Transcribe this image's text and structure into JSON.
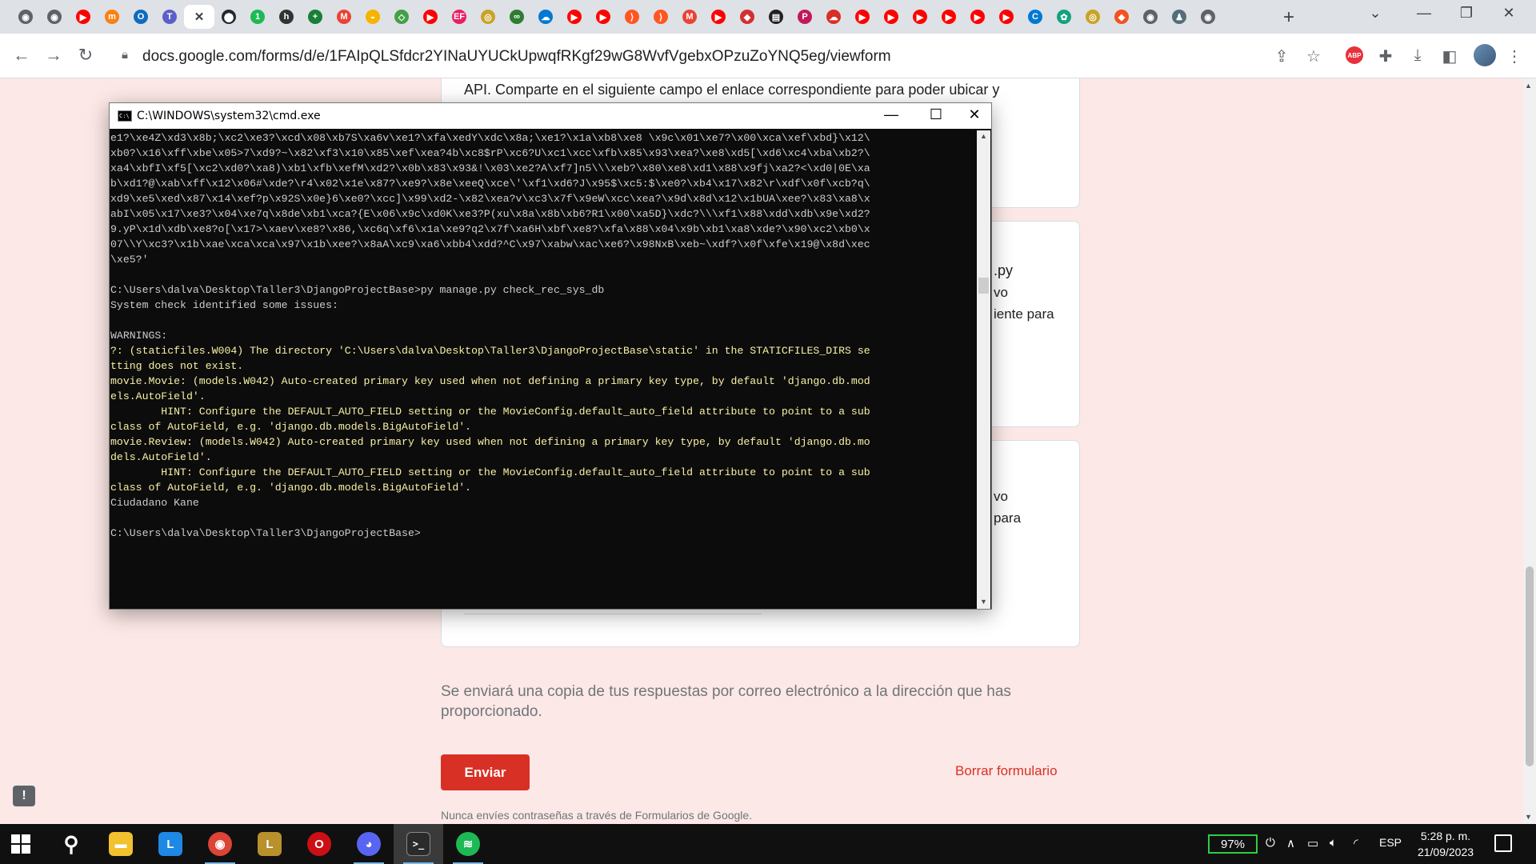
{
  "browser": {
    "tabs": [
      {
        "name": "chrome-tab-icon",
        "color": "#5f6368",
        "glyph": "◉"
      },
      {
        "name": "chrome-tab-icon",
        "color": "#5f6368",
        "glyph": "◉"
      },
      {
        "name": "youtube-tab-icon",
        "color": "#ff0000",
        "glyph": "▶"
      },
      {
        "name": "moodle-tab-icon",
        "color": "#f98012",
        "glyph": "m"
      },
      {
        "name": "outlook-tab-icon",
        "color": "#0f6cbd",
        "glyph": "O"
      },
      {
        "name": "teams-tab-icon",
        "color": "#5b5fc7",
        "glyph": "T"
      },
      {
        "name": "google-forms-tab-icon",
        "color": "#673ab7",
        "glyph": "✕",
        "active": true
      },
      {
        "name": "github-tab-icon",
        "color": "#24292f",
        "glyph": "⬤"
      },
      {
        "name": "tab-icon",
        "color": "#1db954",
        "glyph": "1"
      },
      {
        "name": "tab-icon",
        "color": "#333333",
        "glyph": "h"
      },
      {
        "name": "add-tab-icon",
        "color": "#188038",
        "glyph": "+"
      },
      {
        "name": "gmail-tab-icon",
        "color": "#ea4335",
        "glyph": "M"
      },
      {
        "name": "tab-icon",
        "color": "#f4b400",
        "glyph": "◒"
      },
      {
        "name": "tab-icon",
        "color": "#43a047",
        "glyph": "◇"
      },
      {
        "name": "youtube-tab-icon",
        "color": "#ff0000",
        "glyph": "▶"
      },
      {
        "name": "tab-icon",
        "color": "#e91e63",
        "glyph": "EF"
      },
      {
        "name": "tab-icon",
        "color": "#c9a227",
        "glyph": "◎"
      },
      {
        "name": "tab-icon",
        "color": "#2e7d32",
        "glyph": "∞"
      },
      {
        "name": "onedrive-tab-icon",
        "color": "#0078d4",
        "glyph": "☁"
      },
      {
        "name": "youtube-tab-icon",
        "color": "#ff0000",
        "glyph": "▶"
      },
      {
        "name": "youtube-tab-icon",
        "color": "#ff0000",
        "glyph": "▶"
      },
      {
        "name": "tab-icon",
        "color": "#ff5722",
        "glyph": "⟩"
      },
      {
        "name": "tab-icon",
        "color": "#ff5722",
        "glyph": "⟩"
      },
      {
        "name": "gmail-tab-icon",
        "color": "#ea4335",
        "glyph": "M"
      },
      {
        "name": "youtube-tab-icon",
        "color": "#ff0000",
        "glyph": "▶"
      },
      {
        "name": "tab-icon",
        "color": "#d32f2f",
        "glyph": "◆"
      },
      {
        "name": "tab-icon",
        "color": "#212121",
        "glyph": "▤"
      },
      {
        "name": "tab-icon",
        "color": "#c2185b",
        "glyph": "P"
      },
      {
        "name": "tab-icon",
        "color": "#d93025",
        "glyph": "☁"
      },
      {
        "name": "youtube-tab-icon",
        "color": "#ff0000",
        "glyph": "▶"
      },
      {
        "name": "youtube-tab-icon",
        "color": "#ff0000",
        "glyph": "▶"
      },
      {
        "name": "youtube-tab-icon",
        "color": "#ff0000",
        "glyph": "▶"
      },
      {
        "name": "youtube-tab-icon",
        "color": "#ff0000",
        "glyph": "▶"
      },
      {
        "name": "youtube-tab-icon",
        "color": "#ff0000",
        "glyph": "▶"
      },
      {
        "name": "youtube-tab-icon",
        "color": "#ff0000",
        "glyph": "▶"
      },
      {
        "name": "tab-icon",
        "color": "#0078d4",
        "glyph": "C"
      },
      {
        "name": "chatgpt-tab-icon",
        "color": "#10a37f",
        "glyph": "✿"
      },
      {
        "name": "tab-icon",
        "color": "#c9a227",
        "glyph": "◎"
      },
      {
        "name": "tab-icon",
        "color": "#f4511e",
        "glyph": "◆"
      },
      {
        "name": "chrome-tab-icon",
        "color": "#5f6368",
        "glyph": "◉"
      },
      {
        "name": "tab-icon",
        "color": "#546e7a",
        "glyph": "♟"
      },
      {
        "name": "chrome-tab-icon",
        "color": "#5f6368",
        "glyph": "◉"
      }
    ],
    "url": "docs.google.com/forms/d/e/1FAIpQLSfdcr2YINaUYUCkUpwqfRKgf29wG8WvfVgebxOPzuZoYNQ5eg/viewform"
  },
  "form": {
    "q1_text": "API. Comparte en el siguiente campo el enlace correspondiente para poder ubicar y",
    "q2_peek": [
      ".py",
      "vo",
      "iente para"
    ],
    "q3_peek": [
      "vo",
      "para"
    ],
    "email_note": "Se enviará una copia de tus respuestas por correo electrónico a la dirección que has proporcionado.",
    "submit_label": "Enviar",
    "clear_label": "Borrar formulario",
    "password_note": "Nunca envíes contraseñas a través de Formularios de Google.",
    "accent_color": "#d93025"
  },
  "cmd": {
    "title": "C:\\WINDOWS\\system32\\cmd.exe",
    "icon_text": "C:\\",
    "lines": [
      {
        "t": "e1?\\xe4Z\\xd3\\x8b;\\xc2\\xe3?\\xcd\\x08\\xb7S\\xa6v\\xe1?\\xfa\\xedY\\xdc\\x8a;\\xe1?\\x1a\\xb8\\xe8 \\x9c\\x01\\xe7?\\x00\\xca\\xef\\xbd}\\x12\\"
      },
      {
        "t": "xb0?\\x16\\xff\\xbe\\x05>7\\xd9?~\\x82\\xf3\\x10\\x85\\xef\\xea?4b\\xc8$rP\\xc6?U\\xc1\\xcc\\xfb\\x85\\x93\\xea?\\xe8\\xd5[\\xd6\\xc4\\xba\\xb2?\\"
      },
      {
        "t": "xa4\\xbfI\\xf5[\\xc2\\xd0?\\xa8)\\xb1\\xfb\\xefM\\xd2?\\x0b\\x83\\x93&!\\x03\\xe2?A\\xf7]n5\\\\\\xeb?\\x80\\xe8\\xd1\\x88\\x9fj\\xa2?<\\xd0|0E\\xa"
      },
      {
        "t": "b\\xd1?@\\xab\\xff\\x12\\x06#\\xde?\\r4\\x02\\x1e\\x87?\\xe9?\\x8e\\xeeQ\\xce\\'\\xf1\\xd6?J\\x95$\\xc5:$\\xe0?\\xb4\\x17\\x82\\r\\xdf\\x0f\\xcb?q\\"
      },
      {
        "t": "xd9\\xe5\\xed\\x87\\x14\\xef?p\\x92S\\x0e}6\\xe0?\\xcc]\\x99\\xd2-\\x82\\xea?v\\xc3\\x7f\\x9eW\\xcc\\xea?\\x9d\\x8d\\x12\\x1bUA\\xee?\\x83\\xa8\\x"
      },
      {
        "t": "abI\\x05\\x17\\xe3?\\x04\\xe7q\\x8de\\xb1\\xca?{E\\x06\\x9c\\xd0K\\xe3?P(xu\\x8a\\x8b\\xb6?R1\\x00\\xa5D}\\xdc?\\\\\\xf1\\x88\\xdd\\xdb\\x9e\\xd2?"
      },
      {
        "t": "9.yP\\x1d\\xdb\\xe8?o[\\x17>\\xaev\\xe8?\\x86,\\xc6q\\xf6\\x1a\\xe9?q2\\x7f\\xa6H\\xbf\\xe8?\\xfa\\x88\\x04\\x9b\\xb1\\xa8\\xde?\\x90\\xc2\\xb0\\x"
      },
      {
        "t": "07\\\\Y\\xc3?\\x1b\\xae\\xca\\xca\\x97\\x1b\\xee?\\x8aA\\xc9\\xa6\\xbb4\\xdd?^C\\x97\\xabw\\xac\\xe6?\\x98NxB\\xeb~\\xdf?\\x0f\\xfe\\x19@\\x8d\\xec"
      },
      {
        "t": "\\xe5?'"
      },
      {
        "t": ""
      },
      {
        "t": "C:\\Users\\dalva\\Desktop\\Taller3\\DjangoProjectBase>py manage.py check_rec_sys_db"
      },
      {
        "t": "System check identified some issues:"
      },
      {
        "t": ""
      },
      {
        "t": "WARNINGS:"
      },
      {
        "t": "?: (staticfiles.W004) The directory 'C:\\Users\\dalva\\Desktop\\Taller3\\DjangoProjectBase\\static' in the STATICFILES_DIRS se",
        "warn": true
      },
      {
        "t": "tting does not exist.",
        "warn": true
      },
      {
        "t": "movie.Movie: (models.W042) Auto-created primary key used when not defining a primary key type, by default 'django.db.mod",
        "warn": true
      },
      {
        "t": "els.AutoField'.",
        "warn": true
      },
      {
        "t": "        HINT: Configure the DEFAULT_AUTO_FIELD setting or the MovieConfig.default_auto_field attribute to point to a sub",
        "warn": true
      },
      {
        "t": "class of AutoField, e.g. 'django.db.models.BigAutoField'.",
        "warn": true
      },
      {
        "t": "movie.Review: (models.W042) Auto-created primary key used when not defining a primary key type, by default 'django.db.mo",
        "warn": true
      },
      {
        "t": "dels.AutoField'.",
        "warn": true
      },
      {
        "t": "        HINT: Configure the DEFAULT_AUTO_FIELD setting or the MovieConfig.default_auto_field attribute to point to a sub",
        "warn": true
      },
      {
        "t": "class of AutoField, e.g. 'django.db.models.BigAutoField'.",
        "warn": true
      },
      {
        "t": "Ciudadano Kane"
      },
      {
        "t": ""
      },
      {
        "t": "C:\\Users\\dalva\\Desktop\\Taller3\\DjangoProjectBase>"
      }
    ]
  },
  "taskbar": {
    "apps": [
      {
        "name": "search-icon",
        "glyph": "⚲",
        "color": "transparent"
      },
      {
        "name": "file-explorer-icon",
        "glyph": "▬",
        "color": "#f2c12e"
      },
      {
        "name": "app-l-icon",
        "glyph": "L",
        "color": "#1e88e5"
      },
      {
        "name": "chrome-icon",
        "glyph": "◉",
        "color": "#db4437",
        "running": true
      },
      {
        "name": "league-icon",
        "glyph": "L",
        "color": "#b8902c"
      },
      {
        "name": "opera-icon",
        "glyph": "O",
        "color": "#cc0f16"
      },
      {
        "name": "discord-icon",
        "glyph": "◕",
        "color": "#5865f2",
        "running": true
      },
      {
        "name": "terminal-icon",
        "glyph": ">_",
        "color": "#2b2b2b",
        "running": true,
        "active": true
      },
      {
        "name": "spotify-icon",
        "glyph": "≋",
        "color": "#1db954",
        "running": true
      }
    ],
    "battery": "97%",
    "language": "ESP",
    "time": "5:28 p. m.",
    "date": "21/09/2023"
  }
}
